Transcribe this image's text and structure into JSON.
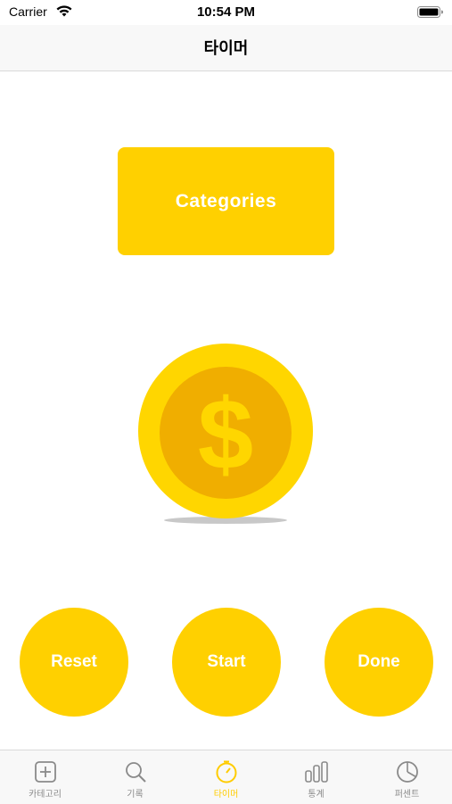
{
  "status_bar": {
    "carrier": "Carrier",
    "time": "10:54 PM"
  },
  "nav": {
    "title": "타이머"
  },
  "main": {
    "categories_label": "Categories",
    "coin_symbol": "$"
  },
  "controls": {
    "reset_label": "Reset",
    "start_label": "Start",
    "done_label": "Done"
  },
  "tab_bar": {
    "active_index": 2,
    "items": [
      {
        "label": "카테고리",
        "icon": "plus-square-icon"
      },
      {
        "label": "기록",
        "icon": "search-icon"
      },
      {
        "label": "타이머",
        "icon": "timer-icon"
      },
      {
        "label": "통계",
        "icon": "bar-chart-icon"
      },
      {
        "label": "퍼센트",
        "icon": "pie-chart-icon"
      }
    ]
  },
  "colors": {
    "accent": "#ffd000",
    "coin_outer": "#ffd600",
    "coin_inner": "#f0ae00",
    "tab_active": "#ffcc00",
    "tab_inactive": "#8a8a8a"
  }
}
